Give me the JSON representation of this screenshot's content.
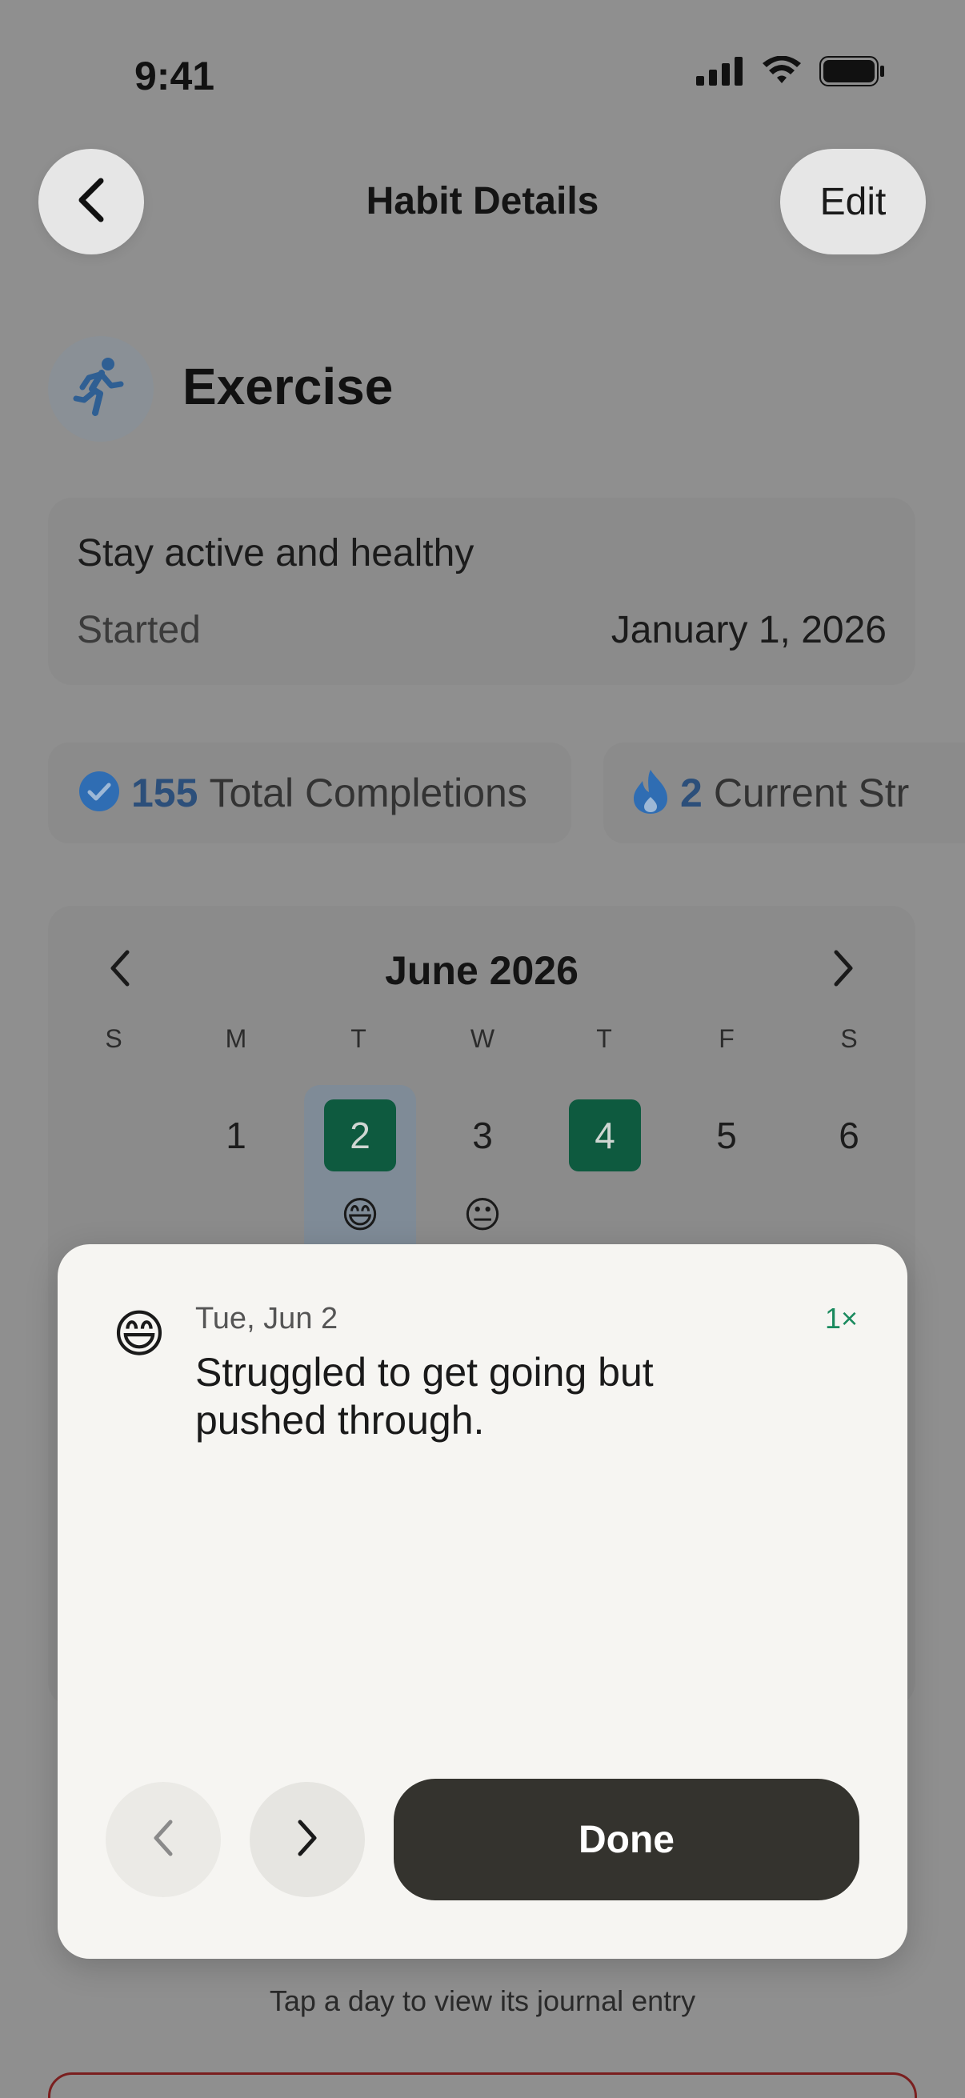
{
  "status_bar": {
    "time": "9:41",
    "icons": [
      "signal-icon",
      "wifi-icon",
      "battery-icon"
    ]
  },
  "header": {
    "title": "Habit Details",
    "back_icon": "chevron-left-icon",
    "edit_label": "Edit"
  },
  "habit": {
    "name": "Exercise",
    "icon": "running-person-icon",
    "accent": "#2f6db3"
  },
  "info": {
    "description": "Stay active and healthy",
    "started_label": "Started",
    "started_value": "January 1, 2026"
  },
  "stats": [
    {
      "icon": "checkmark-circle-icon",
      "value": "155",
      "label": "Total Completions"
    },
    {
      "icon": "flame-icon",
      "value": "2",
      "label": "Current Str"
    }
  ],
  "calendar": {
    "title": "June 2026",
    "weekdays": [
      "S",
      "M",
      "T",
      "W",
      "T",
      "F",
      "S"
    ],
    "days": [
      {
        "day": "1",
        "completed": false
      },
      {
        "day": "2",
        "completed": true,
        "selected": true,
        "mood": "😄"
      },
      {
        "day": "3",
        "completed": false,
        "mood": "😐"
      },
      {
        "day": "4",
        "completed": true
      },
      {
        "day": "5",
        "completed": false
      },
      {
        "day": "6",
        "completed": false
      }
    ],
    "completed_color": "#0e5a3f"
  },
  "journal_sheet": {
    "mood": "😄",
    "date": "Tue, Jun 2",
    "count": "1×",
    "text": "Struggled to get going but pushed through.",
    "done_label": "Done"
  },
  "footer": {
    "hint": "Tap a day to view its journal entry"
  }
}
